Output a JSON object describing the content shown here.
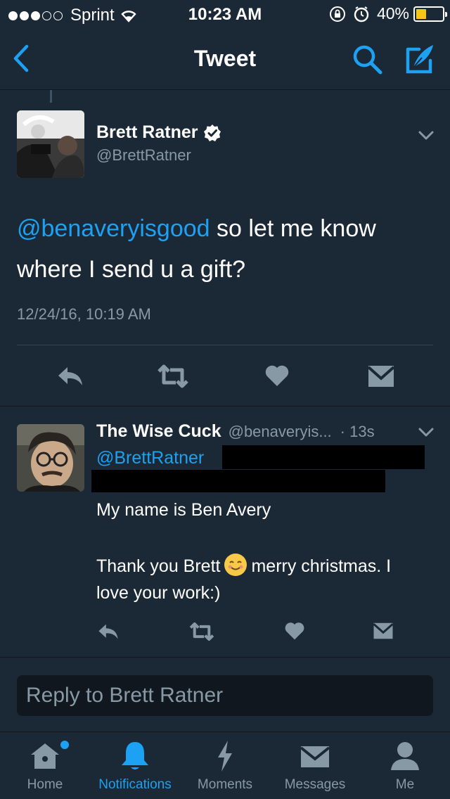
{
  "status_bar": {
    "carrier": "Sprint",
    "time": "10:23 AM",
    "battery": "40%",
    "battery_level": 0.4
  },
  "nav": {
    "title": "Tweet"
  },
  "tweet": {
    "author_name": "Brett Ratner",
    "author_handle": "@BrettRatner",
    "mention": "@benaveryisgood",
    "text": " so let me know where I send u a gift?",
    "timestamp": "12/24/16, 10:19 AM"
  },
  "reply": {
    "author_name": "The Wise Cuck",
    "author_handle": "@benaveryis...",
    "time": "· 13s",
    "mention": "@BrettRatner",
    "line1": "My name is Ben Avery",
    "line2a": "Thank you Brett",
    "line2b": "merry christmas. I love your work:)"
  },
  "reply_box": {
    "placeholder": "Reply to Brett Ratner"
  },
  "tabs": [
    {
      "label": "Home",
      "icon": "home-icon"
    },
    {
      "label": "Notifications",
      "icon": "bell-icon"
    },
    {
      "label": "Moments",
      "icon": "lightning-icon"
    },
    {
      "label": "Messages",
      "icon": "envelope-icon"
    },
    {
      "label": "Me",
      "icon": "person-icon"
    }
  ],
  "colors": {
    "background": "#1b2836",
    "accent": "#1da1f2",
    "secondary_text": "#8899a6",
    "battery": "#f5c518"
  }
}
